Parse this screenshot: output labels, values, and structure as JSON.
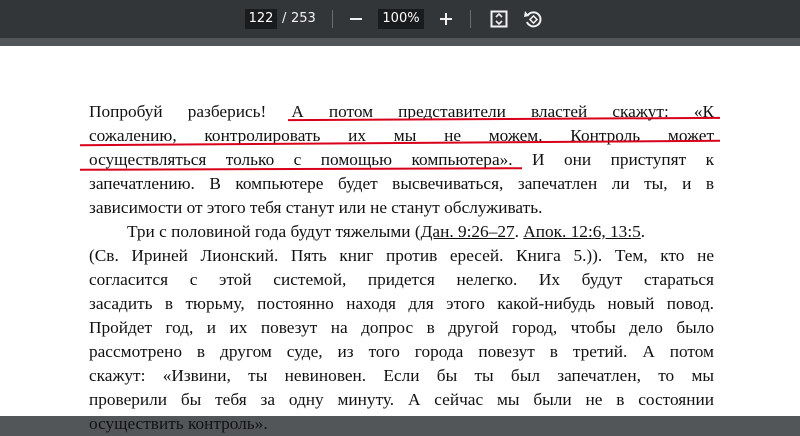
{
  "toolbar": {
    "current_page": "122",
    "page_separator": "/",
    "total_pages": "253",
    "zoom": "100%",
    "icons": [
      "zoom-out-icon",
      "zoom-in-icon",
      "fit-page-icon",
      "rotate-icon"
    ]
  },
  "document": {
    "lines": [
      "Попробуй разберись! А потом представители властей скажут: «К",
      "сожалению, контролировать их мы не можем. Контроль может",
      "осуществляться только с помощью компьютера». И они приступят к",
      "запечатлению. В компьютере будет высвечиваться, запечатлен ли ты, и в",
      "зависимости от этого тебя станут или не станут обслуживать."
    ],
    "p2_line1_pre": "Три с половиной года будут тяжелыми (",
    "p2_link1": "Дан. 9:26–27",
    "p2_line1_mid": ". ",
    "p2_link2": "Апок. 12:6, 13:5",
    "p2_line1_post": ".",
    "p2_lines": [
      "(Св. Ириней Лионский. Пять книг против ересей. Книга 5.)). Тем, кто не",
      "согласится с этой системой, придется нелегко. Их будут стараться",
      "засадить в тюрьму, постоянно находя для этого какой-нибудь новый повод.",
      "Пройдет год, и их повезут на допрос в другой город, чтобы дело было",
      "рассмотрено в другом суде, из того города повезут в третий. А потом",
      "скажут: «Извини, ты невиновен. Если бы ты был запечатлен, то мы",
      "проверили бы тебя за одну минуту. А сейчас мы были не в состоянии",
      "осуществить контроль»."
    ]
  },
  "colors": {
    "toolbar_bg": "#323639",
    "underline_red": "#d9001b",
    "viewer_bg": "#525659"
  }
}
